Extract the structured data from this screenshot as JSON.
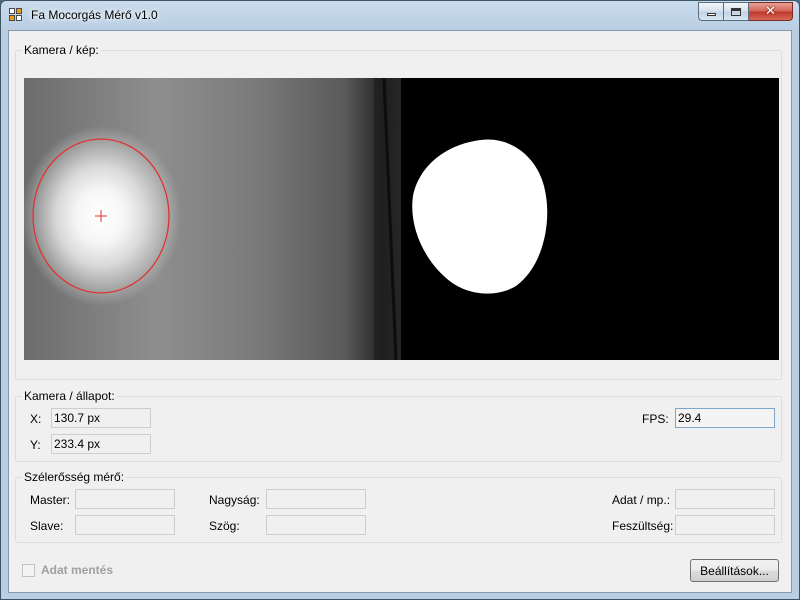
{
  "window": {
    "title": "Fa Mocorgás Mérő v1.0",
    "icons": {
      "app": "app-icon",
      "minimize": "minimize-icon",
      "maximize": "maximize-icon",
      "close": "close-icon",
      "close_glyph": "✕"
    }
  },
  "camera_group": {
    "title": "Kamera / kép:",
    "overlay_color": "#e0332f"
  },
  "status_group": {
    "title": "Kamera / állapot:",
    "x_label": "X:",
    "x_value": "130.7 px",
    "y_label": "Y:",
    "y_value": "233.4 px",
    "fps_label": "FPS:",
    "fps_value": "29.4"
  },
  "wind_group": {
    "title": "Szélerősség mérő:",
    "master_label": "Master:",
    "master_value": "",
    "slave_label": "Slave:",
    "slave_value": "",
    "size_label": "Nagyság:",
    "size_value": "",
    "angle_label": "Szög:",
    "angle_value": "",
    "rate_label": "Adat / mp.:",
    "rate_value": "",
    "voltage_label": "Feszültség:",
    "voltage_value": ""
  },
  "bottom": {
    "save_label": "Adat mentés",
    "save_checked": false,
    "settings_label": "Beállítások..."
  }
}
